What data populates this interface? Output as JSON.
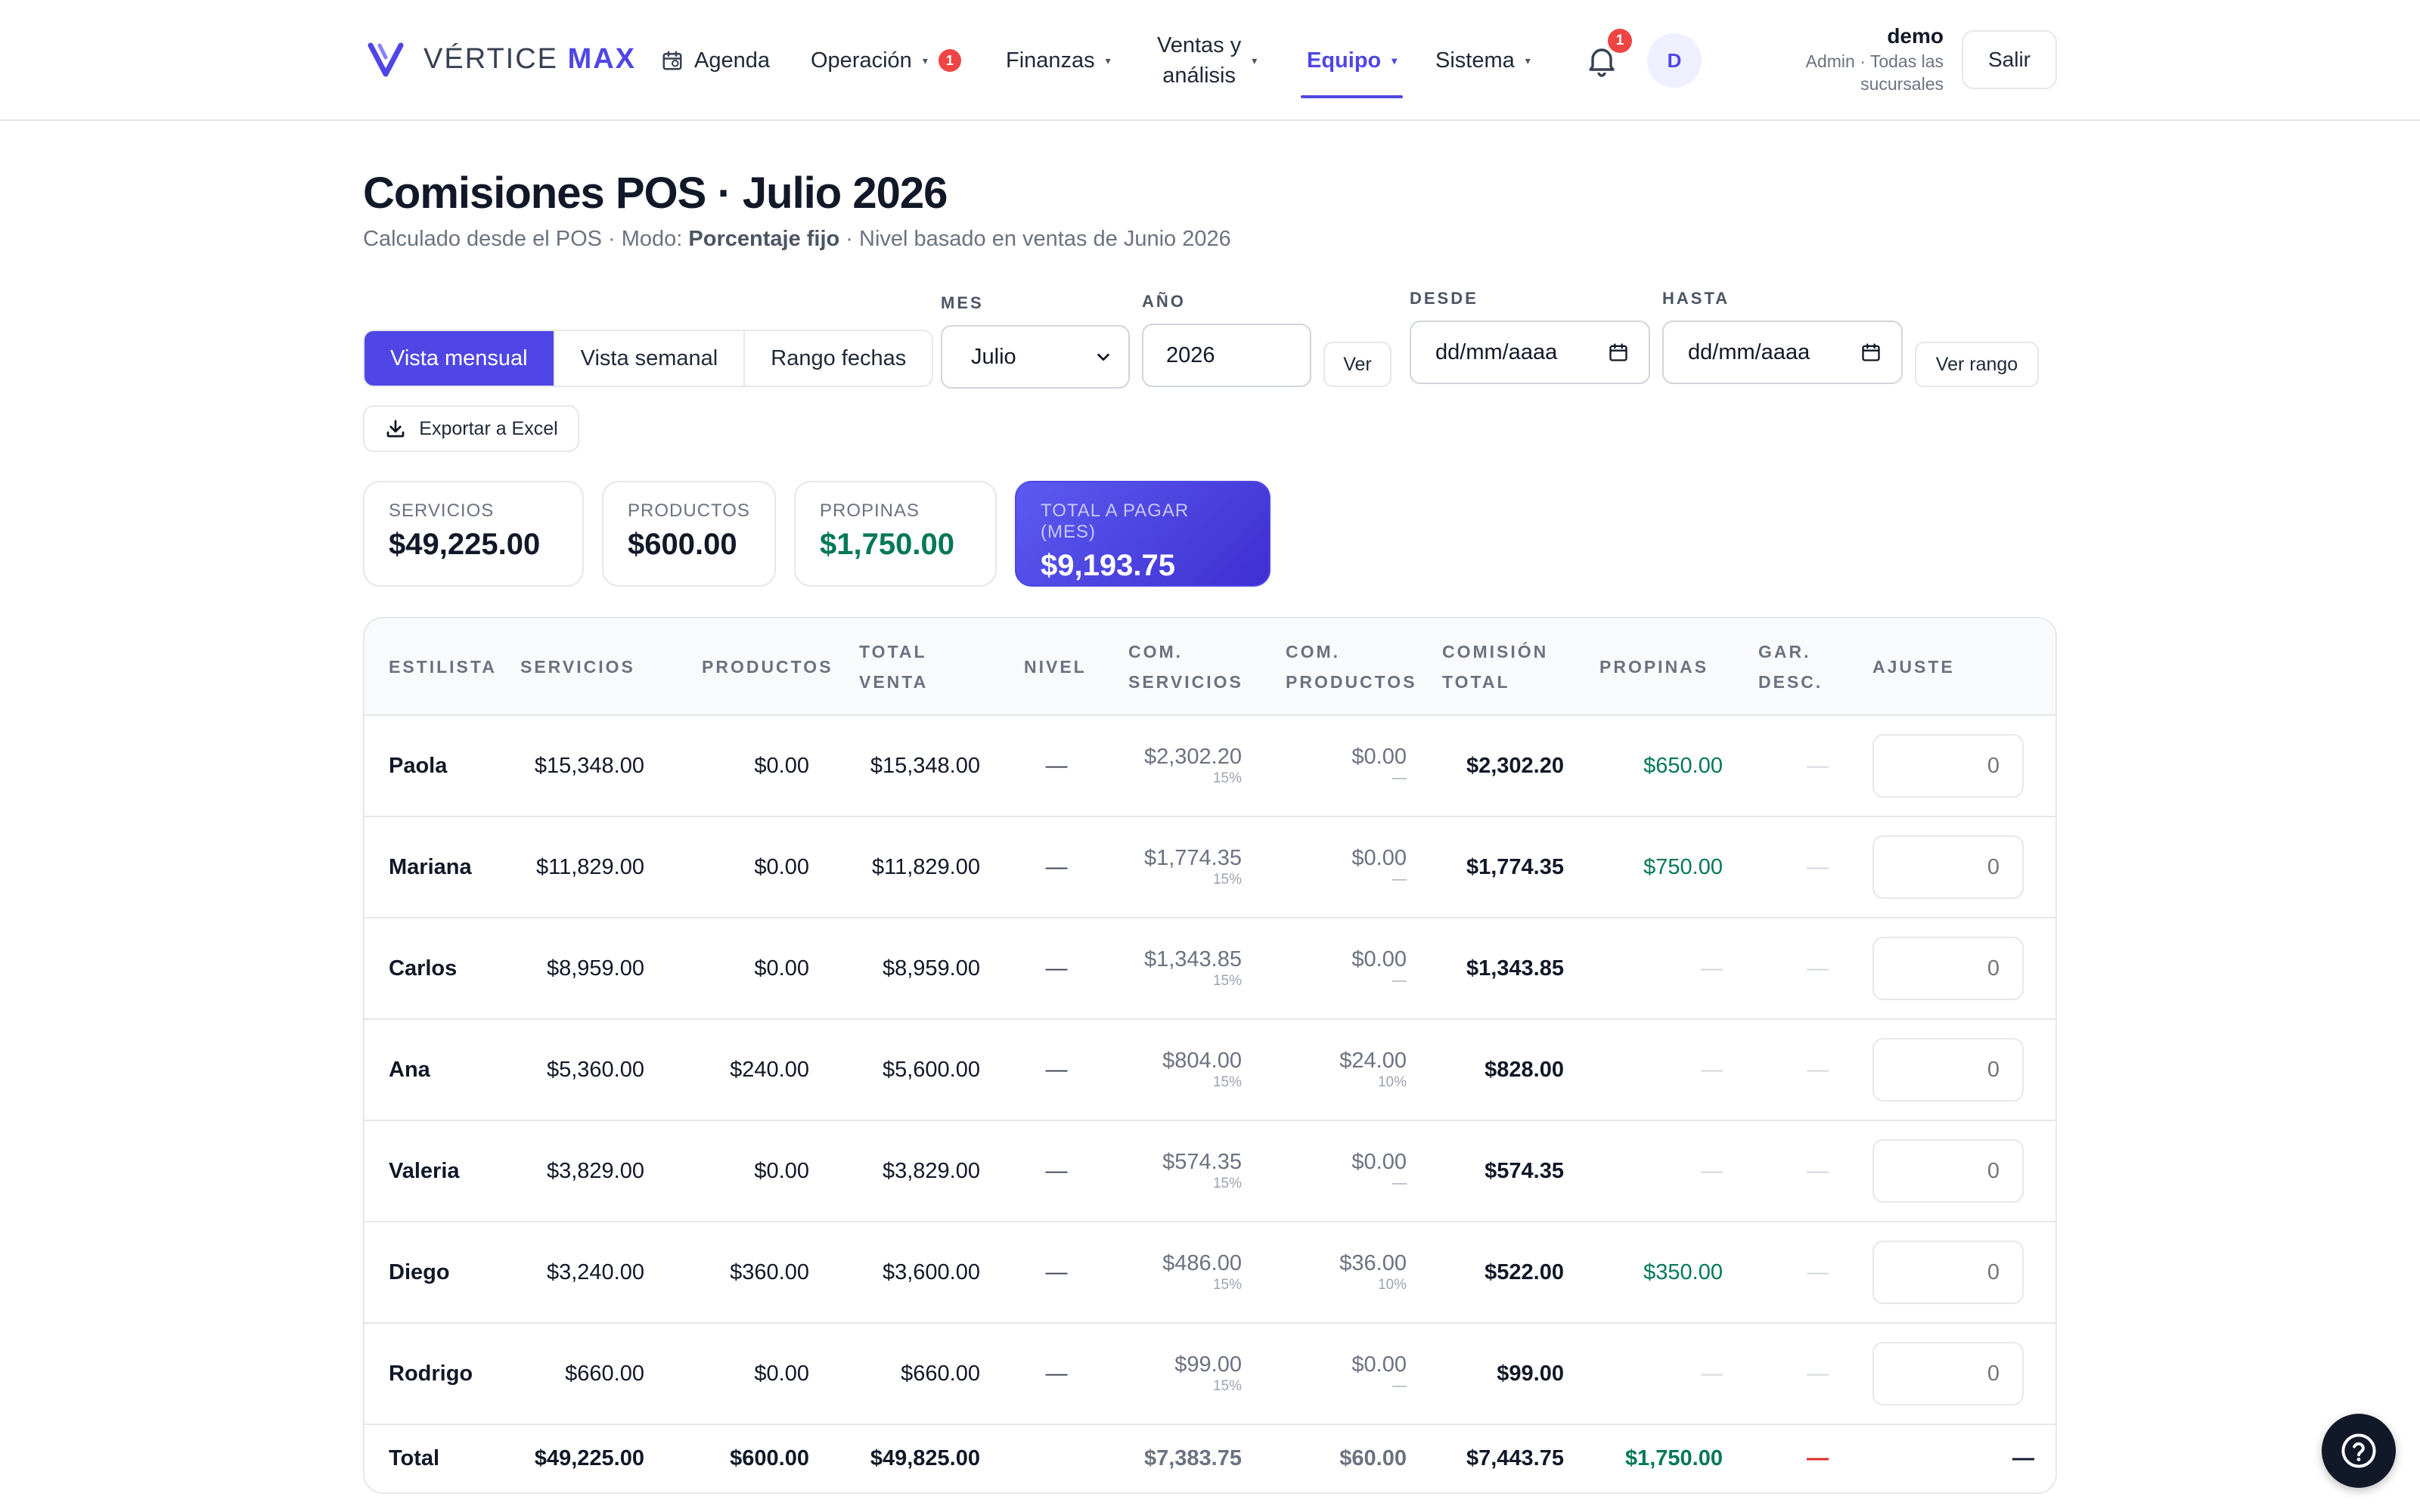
{
  "app": {
    "brand_prefix": "VÉRTICE",
    "brand_suffix": "MAX",
    "brand_color": "#4f46e5"
  },
  "nav": {
    "agenda": "Agenda",
    "operacion": "Operación",
    "operacion_badge": "1",
    "finanzas": "Finanzas",
    "ventas_line1": "Ventas y",
    "ventas_line2": "análisis",
    "equipo": "Equipo",
    "sistema": "Sistema",
    "active": "equipo"
  },
  "header": {
    "bell_badge": "1",
    "avatar_initial": "D",
    "user_name": "demo",
    "user_role": "Admin · Todas las sucursales",
    "logout": "Salir"
  },
  "page": {
    "title": "Comisiones POS · Julio 2026",
    "sub_prefix": "Calculado desde el POS · Modo: ",
    "sub_mode": "Porcentaje fijo",
    "sub_suffix": " · Nivel basado en ventas de Junio 2026"
  },
  "controls": {
    "tabs": [
      "Vista mensual",
      "Vista semanal",
      "Rango fechas"
    ],
    "active_tab": 0,
    "mes_label": "MES",
    "mes_value": "Julio",
    "anio_label": "AÑO",
    "anio_value": "2026",
    "ver": "Ver",
    "desde_label": "DESDE",
    "desde_value": "dd/mm/aaaa",
    "hasta_label": "HASTA",
    "hasta_value": "dd/mm/aaaa",
    "ver_rango": "Ver rango",
    "export": "Exportar a Excel"
  },
  "kpis": {
    "servicios_label": "SERVICIOS",
    "servicios_value": "$49,225.00",
    "productos_label": "PRODUCTOS",
    "productos_value": "$600.00",
    "propinas_label": "PROPINAS",
    "propinas_value": "$1,750.00",
    "total_label": "TOTAL A PAGAR (MES)",
    "total_value": "$9,193.75"
  },
  "table": {
    "headers": {
      "estilista": "ESTILISTA",
      "servicios": "SERVICIOS",
      "productos": "PRODUCTOS",
      "total_venta_1": "TOTAL",
      "total_venta_2": "VENTA",
      "nivel": "NIVEL",
      "com_serv_1": "COM.",
      "com_serv_2": "SERVICIOS",
      "com_prod_1": "COM.",
      "com_prod_2": "PRODUCTOS",
      "com_total_1": "COMISIÓN",
      "com_total_2": "TOTAL",
      "propinas": "PROPINAS",
      "gar_1": "GAR.",
      "gar_2": "DESC.",
      "ajuste": "AJUSTE"
    },
    "rows": [
      {
        "name": "Paola",
        "servicios": "$15,348.00",
        "productos": "$0.00",
        "total_venta": "$15,348.00",
        "nivel": "—",
        "com_serv": "$2,302.20",
        "com_serv_pct": "15%",
        "com_prod": "$0.00",
        "com_prod_pct": "—",
        "com_total": "$2,302.20",
        "propinas": "$650.00",
        "gar": "—",
        "ajuste": "0"
      },
      {
        "name": "Mariana",
        "servicios": "$11,829.00",
        "productos": "$0.00",
        "total_venta": "$11,829.00",
        "nivel": "—",
        "com_serv": "$1,774.35",
        "com_serv_pct": "15%",
        "com_prod": "$0.00",
        "com_prod_pct": "—",
        "com_total": "$1,774.35",
        "propinas": "$750.00",
        "gar": "—",
        "ajuste": "0"
      },
      {
        "name": "Carlos",
        "servicios": "$8,959.00",
        "productos": "$0.00",
        "total_venta": "$8,959.00",
        "nivel": "—",
        "com_serv": "$1,343.85",
        "com_serv_pct": "15%",
        "com_prod": "$0.00",
        "com_prod_pct": "—",
        "com_total": "$1,343.85",
        "propinas": "—",
        "gar": "—",
        "ajuste": "0"
      },
      {
        "name": "Ana",
        "servicios": "$5,360.00",
        "productos": "$240.00",
        "total_venta": "$5,600.00",
        "nivel": "—",
        "com_serv": "$804.00",
        "com_serv_pct": "15%",
        "com_prod": "$24.00",
        "com_prod_pct": "10%",
        "com_total": "$828.00",
        "propinas": "—",
        "gar": "—",
        "ajuste": "0"
      },
      {
        "name": "Valeria",
        "servicios": "$3,829.00",
        "productos": "$0.00",
        "total_venta": "$3,829.00",
        "nivel": "—",
        "com_serv": "$574.35",
        "com_serv_pct": "15%",
        "com_prod": "$0.00",
        "com_prod_pct": "—",
        "com_total": "$574.35",
        "propinas": "—",
        "gar": "—",
        "ajuste": "0"
      },
      {
        "name": "Diego",
        "servicios": "$3,240.00",
        "productos": "$360.00",
        "total_venta": "$3,600.00",
        "nivel": "—",
        "com_serv": "$486.00",
        "com_serv_pct": "15%",
        "com_prod": "$36.00",
        "com_prod_pct": "10%",
        "com_total": "$522.00",
        "propinas": "$350.00",
        "gar": "—",
        "ajuste": "0"
      },
      {
        "name": "Rodrigo",
        "servicios": "$660.00",
        "productos": "$0.00",
        "total_venta": "$660.00",
        "nivel": "—",
        "com_serv": "$99.00",
        "com_serv_pct": "15%",
        "com_prod": "$0.00",
        "com_prod_pct": "—",
        "com_total": "$99.00",
        "propinas": "—",
        "gar": "—",
        "ajuste": "0"
      }
    ],
    "totals": {
      "label": "Total",
      "servicios": "$49,225.00",
      "productos": "$600.00",
      "total_venta": "$49,825.00",
      "com_serv": "$7,383.75",
      "com_prod": "$60.00",
      "com_total": "$7,443.75",
      "propinas": "$1,750.00",
      "gar": "—",
      "ajuste": "—"
    }
  }
}
